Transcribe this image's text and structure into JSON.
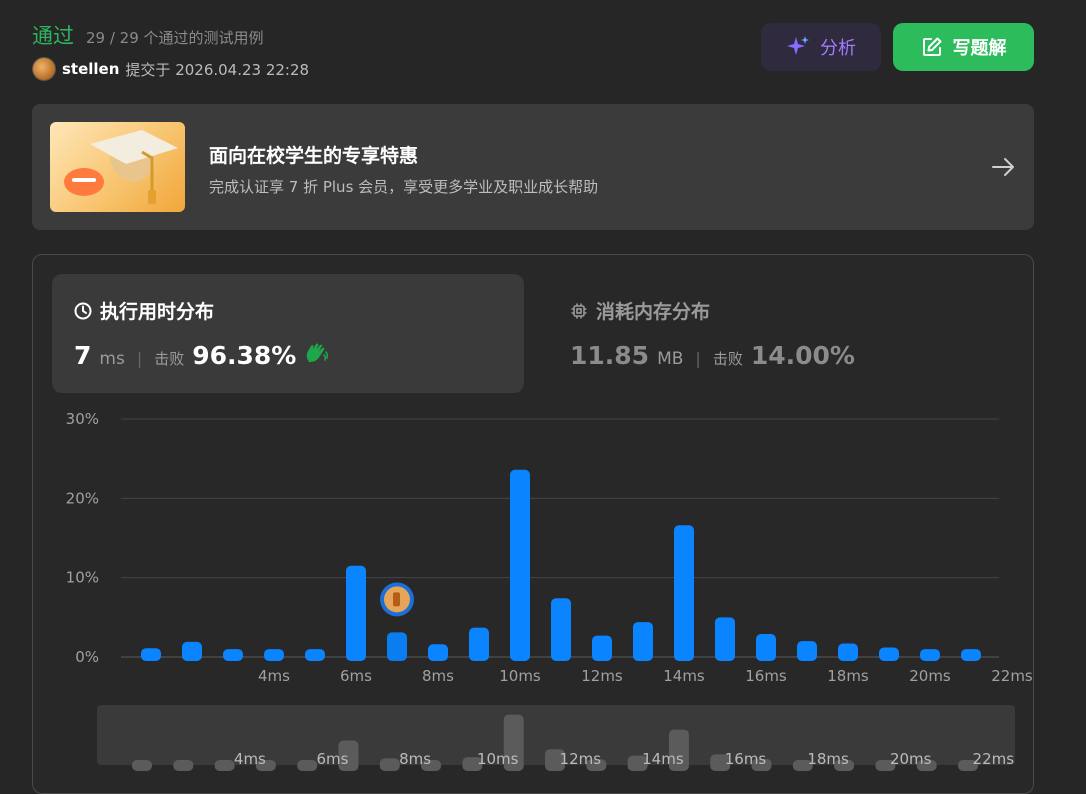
{
  "header": {
    "status": "通过",
    "cases": "29 / 29 个通过的测试用例",
    "username": "stellen",
    "submitted": "提交于 2026.04.23 22:28"
  },
  "buttons": {
    "analyze_label": "分析",
    "solution_label": "写题解"
  },
  "promo": {
    "title": "面向在校学生的专享特惠",
    "subtitle": "完成认证享 7 折 Plus 会员，享受更多学业及职业成长帮助"
  },
  "runtime": {
    "title": "执行用时分布",
    "value": "7",
    "unit": "ms",
    "beat_label": "击败",
    "beat_value": "96.38%"
  },
  "memory": {
    "title": "消耗内存分布",
    "value": "11.85",
    "unit": "MB",
    "beat_label": "击败",
    "beat_value": "14.00%"
  },
  "colors": {
    "accent_green": "#2db55d",
    "bar_blue": "#0a84ff",
    "analyze_purple": "#a37bff"
  },
  "chart_data": {
    "type": "bar",
    "title": "",
    "xlabel": "",
    "ylabel": "",
    "x_labels": [
      "4ms",
      "6ms",
      "8ms",
      "10ms",
      "12ms",
      "14ms",
      "16ms",
      "18ms",
      "20ms",
      "22ms"
    ],
    "y_ticks": [
      "0%",
      "10%",
      "20%",
      "30%"
    ],
    "ylim": [
      0,
      30
    ],
    "x": [
      1,
      2,
      3,
      4,
      5,
      6,
      7,
      8,
      9,
      10,
      11,
      12,
      13,
      14,
      15,
      16,
      17,
      18,
      19,
      20,
      21,
      22
    ],
    "values": [
      1.1,
      1.9,
      1.0,
      1.0,
      1.0,
      11.5,
      3.1,
      1.6,
      3.7,
      23.6,
      7.4,
      2.7,
      4.4,
      16.6,
      5.0,
      2.9,
      2.0,
      1.7,
      1.2,
      1.0,
      1.0
    ],
    "highlight_x": 7,
    "grid": true
  }
}
